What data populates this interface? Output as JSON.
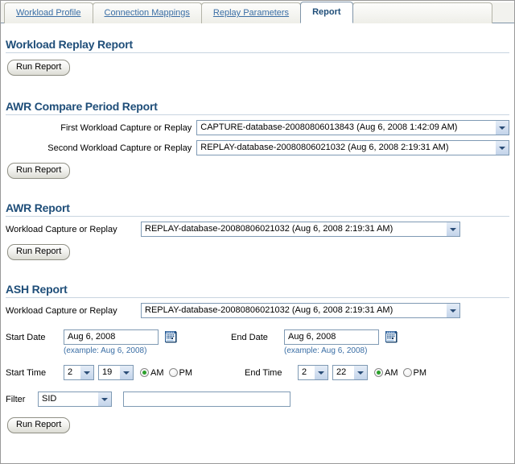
{
  "tabs": [
    {
      "label": "Workload Profile",
      "active": false
    },
    {
      "label": "Connection Mappings",
      "active": false
    },
    {
      "label": "Replay Parameters",
      "active": false
    },
    {
      "label": "Report",
      "active": true
    }
  ],
  "sections": {
    "workload_replay": {
      "title": "Workload Replay Report",
      "run_button": "Run Report"
    },
    "awr_compare": {
      "title": "AWR Compare Period Report",
      "first_label": "First Workload Capture or Replay",
      "first_value": "CAPTURE-database-20080806013843 (Aug 6, 2008 1:42:09 AM)",
      "second_label": "Second Workload Capture or Replay",
      "second_value": "REPLAY-database-20080806021032 (Aug 6, 2008 2:19:31 AM)",
      "run_button": "Run Report"
    },
    "awr_report": {
      "title": "AWR Report",
      "capture_label": "Workload Capture or Replay",
      "capture_value": "REPLAY-database-20080806021032 (Aug 6, 2008 2:19:31 AM)",
      "run_button": "Run Report"
    },
    "ash_report": {
      "title": "ASH Report",
      "capture_label": "Workload Capture or Replay",
      "capture_value": "REPLAY-database-20080806021032 (Aug 6, 2008 2:19:31 AM)",
      "start_date_label": "Start Date",
      "start_date_value": "Aug 6, 2008",
      "start_date_hint": "(example: Aug 6, 2008)",
      "end_date_label": "End Date",
      "end_date_value": "Aug 6, 2008",
      "end_date_hint": "(example: Aug 6, 2008)",
      "start_time_label": "Start Time",
      "start_time_hour": "2",
      "start_time_minute": "19",
      "start_time_am_label": "AM",
      "start_time_pm_label": "PM",
      "start_time_meridiem": "AM",
      "end_time_label": "End Time",
      "end_time_hour": "2",
      "end_time_minute": "22",
      "end_time_am_label": "AM",
      "end_time_pm_label": "PM",
      "end_time_meridiem": "AM",
      "filter_label": "Filter",
      "filter_value": "SID",
      "filter_text_value": "",
      "run_button": "Run Report"
    }
  },
  "colors": {
    "heading": "#1f4e79",
    "link": "#3a6ea5",
    "field_border": "#7f9ab4",
    "rule": "#c8d4e0",
    "radio_selected": "#2ca02c"
  }
}
